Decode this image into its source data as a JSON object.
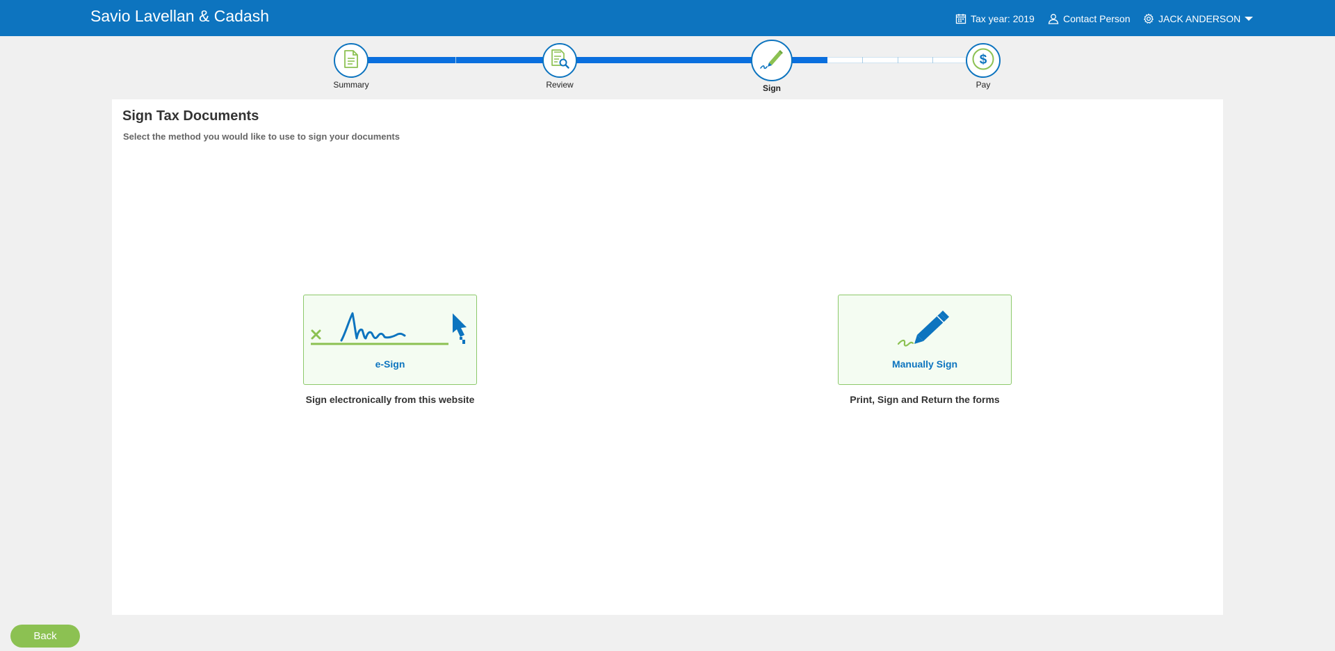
{
  "header": {
    "brand": "Savio Lavellan & Cadash",
    "tax_year": "Tax year: 2019",
    "contact": "Contact Person",
    "user": "JACK ANDERSON",
    "bg_color": "#0d74bf"
  },
  "stepper": {
    "steps": [
      {
        "label": "Summary",
        "icon": "document-icon",
        "state": "done"
      },
      {
        "label": "Review",
        "icon": "document-search-icon",
        "state": "done"
      },
      {
        "label": "Sign",
        "icon": "pen-signature-icon",
        "state": "active"
      },
      {
        "label": "Pay",
        "icon": "dollar-icon",
        "state": "todo"
      }
    ]
  },
  "page": {
    "title": "Sign Tax Documents",
    "subtitle": "Select the method you would like to use to sign your documents"
  },
  "options": [
    {
      "title": "e-Sign",
      "description": "Sign electronically from this website",
      "icon": "esignature-icon"
    },
    {
      "title": "Manually Sign",
      "description": "Print, Sign and Return the forms",
      "icon": "pen-icon"
    }
  ],
  "footer": {
    "back_label": "Back"
  },
  "colors": {
    "primary": "#0d74bf",
    "accent_green": "#8cc152",
    "card_border": "#8cc96a"
  }
}
